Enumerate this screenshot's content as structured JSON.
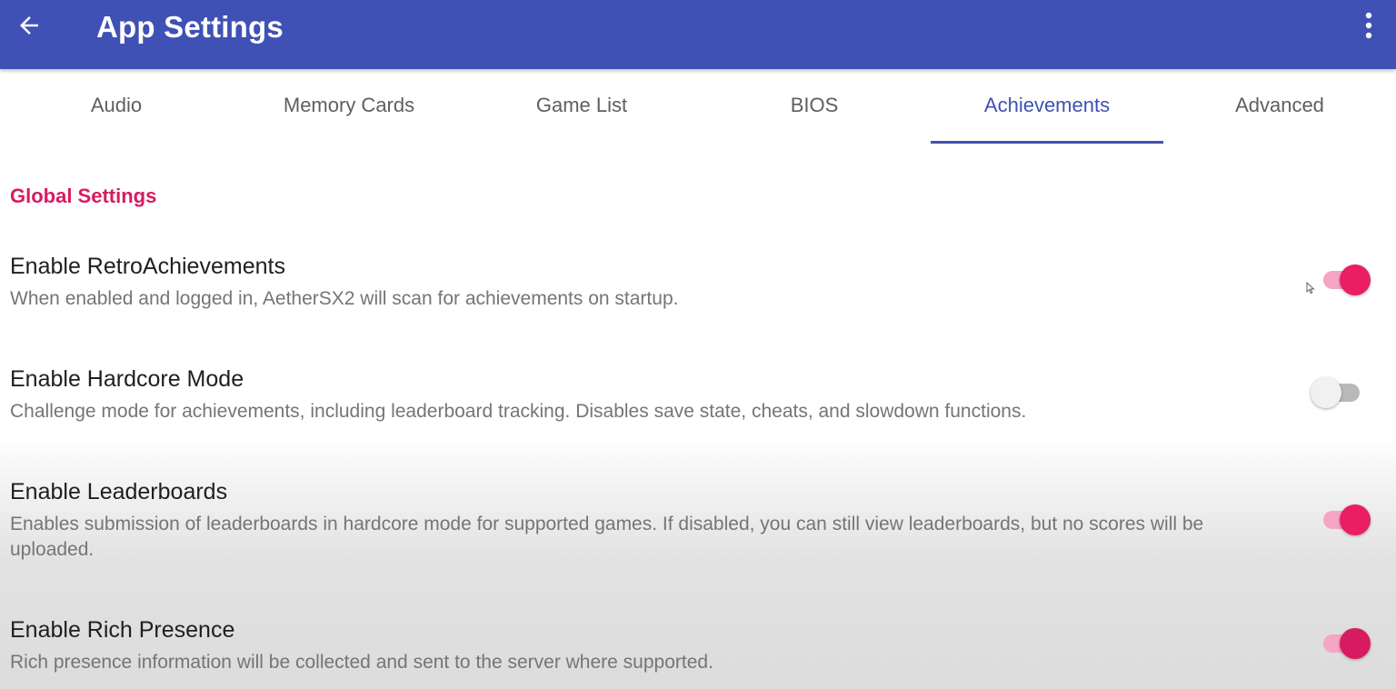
{
  "appbar": {
    "title": "App Settings",
    "back_icon": "arrow-left-icon",
    "overflow_icon": "more-vert-icon",
    "color": "#3f51b5"
  },
  "tabs": [
    {
      "label": "Audio",
      "active": false
    },
    {
      "label": "Memory Cards",
      "active": false
    },
    {
      "label": "Game List",
      "active": false
    },
    {
      "label": "BIOS",
      "active": false
    },
    {
      "label": "Achievements",
      "active": true
    },
    {
      "label": "Advanced",
      "active": false
    }
  ],
  "section": {
    "header": "Global Settings",
    "color": "#d81b60"
  },
  "preferences": [
    {
      "title": "Enable RetroAchievements",
      "summary": "When enabled and logged in, AetherSX2 will scan for achievements on startup.",
      "enabled": true
    },
    {
      "title": "Enable Hardcore Mode",
      "summary": "Challenge mode for achievements, including leaderboard tracking. Disables save state, cheats, and slowdown functions.",
      "enabled": false
    },
    {
      "title": "Enable Leaderboards",
      "summary": "Enables submission of leaderboards in hardcore mode for supported games. If disabled, you can still view leaderboards, but no scores will be uploaded.",
      "enabled": true
    },
    {
      "title": "Enable Rich Presence",
      "summary": "Rich presence information will be collected and sent to the server where supported.",
      "enabled": true
    }
  ],
  "colors": {
    "accent": "#e91e63",
    "tab_active": "#3f51b5"
  }
}
